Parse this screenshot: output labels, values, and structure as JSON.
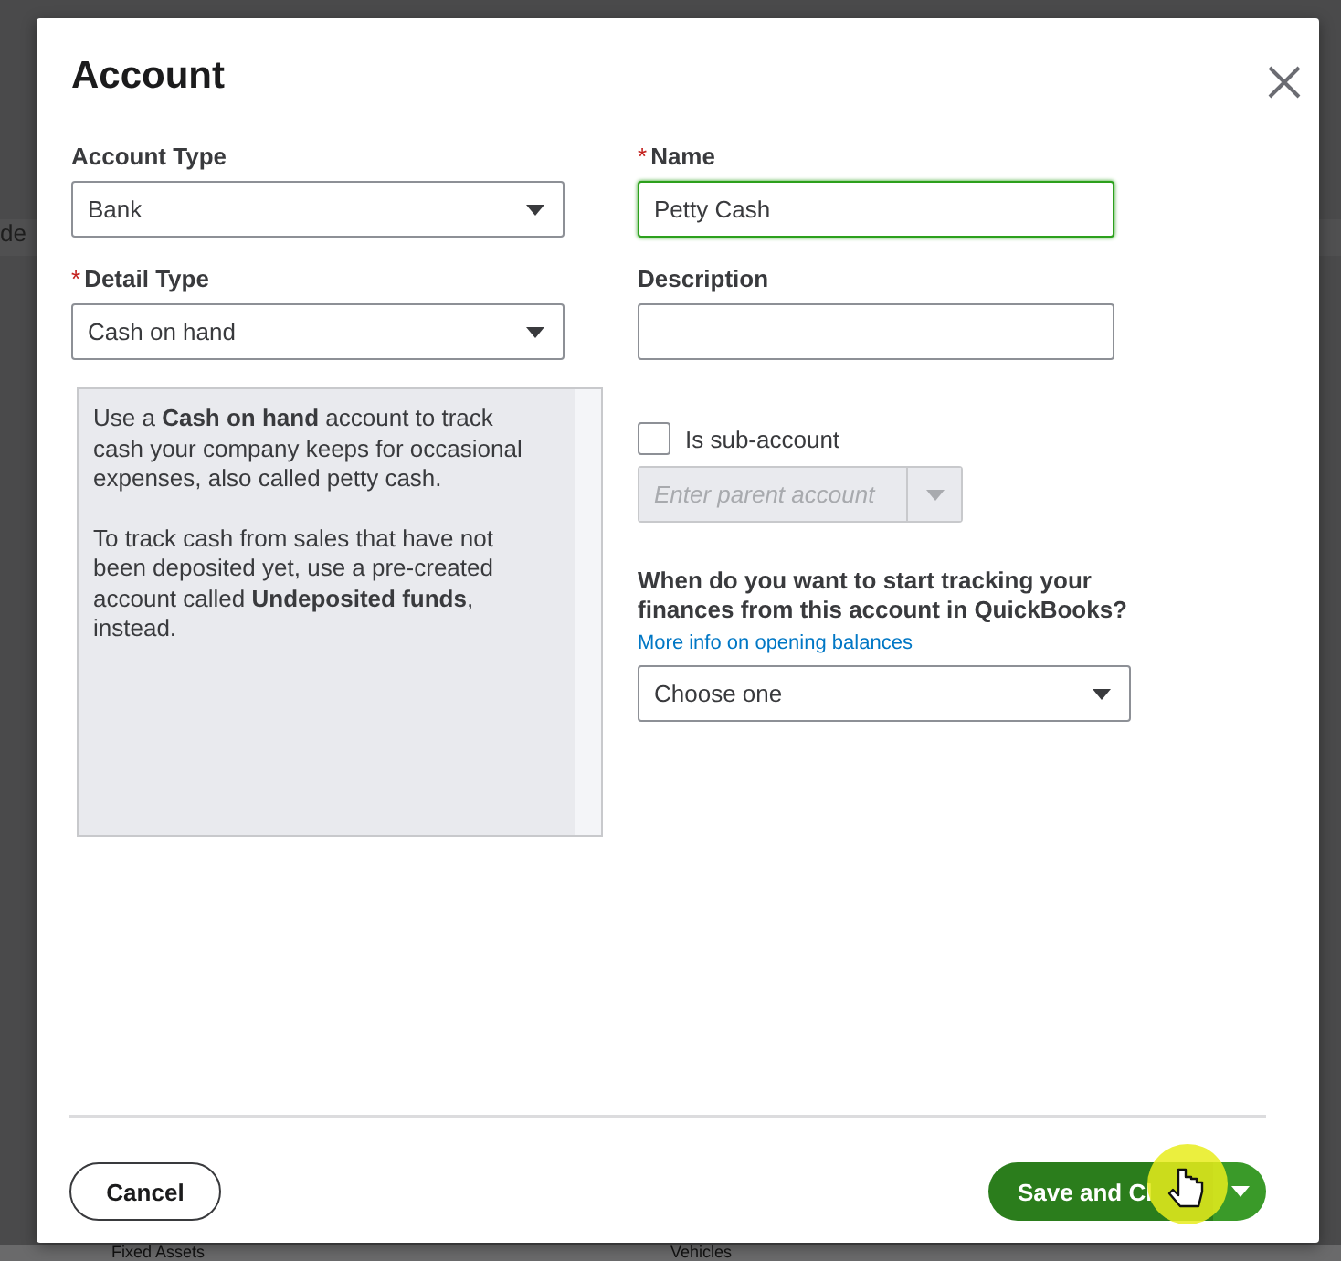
{
  "background": {
    "texts": [
      "de",
      "Fixed Assets",
      "Vehicles"
    ]
  },
  "dialog": {
    "title": "Account",
    "required_mark": "*",
    "account_type": {
      "label": "Account Type",
      "required": false,
      "value": "Bank"
    },
    "detail_type": {
      "label": "Detail Type",
      "required": true,
      "value": "Cash on hand"
    },
    "help_paragraphs": [
      "Use a **Cash on hand** account to track cash your company keeps for occasional expenses, also called petty cash.",
      "To track cash from sales that have not been deposited yet, use a pre-created account called **Undeposited funds**, instead."
    ],
    "name": {
      "label": "Name",
      "required": true,
      "value": "Petty Cash",
      "focused": true
    },
    "description": {
      "label": "Description",
      "required": false,
      "focused": false
    },
    "sub_account": {
      "label": "Is sub-account",
      "checked": false
    },
    "parent_account": {
      "placeholder": "Enter parent account",
      "disabled": true
    },
    "tracking_question": "When do you want to start tracking your finances from this account in QuickBooks?",
    "opening_balance_link": "More info on opening balances",
    "start_tracking": {
      "value": "Choose one"
    },
    "cancel_button": "Cancel",
    "save_button": "Save and Cl"
  }
}
